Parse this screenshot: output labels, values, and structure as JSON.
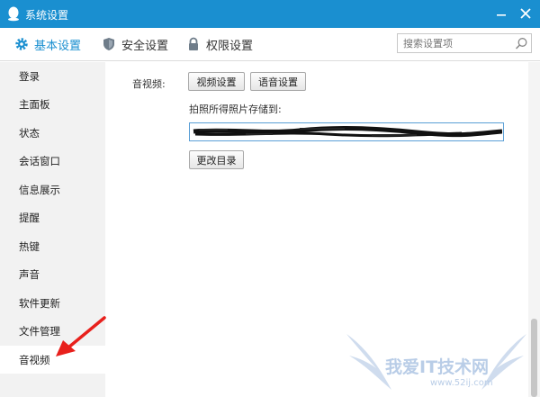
{
  "window": {
    "title": "系统设置",
    "app_icon": "qq-penguin-icon",
    "minimize_icon": "minimize-icon",
    "close_icon": "close-icon",
    "accent_color": "#1a8fd0"
  },
  "topnav": {
    "tabs": [
      {
        "label": "基本设置",
        "icon": "gear-icon",
        "active": true
      },
      {
        "label": "安全设置",
        "icon": "shield-icon",
        "active": false
      },
      {
        "label": "权限设置",
        "icon": "lock-icon",
        "active": false
      }
    ],
    "search": {
      "placeholder": "搜索设置项",
      "icon": "search-icon"
    }
  },
  "sidebar": {
    "items": [
      {
        "label": "登录"
      },
      {
        "label": "主面板"
      },
      {
        "label": "状态"
      },
      {
        "label": "会话窗口"
      },
      {
        "label": "信息展示"
      },
      {
        "label": "提醒"
      },
      {
        "label": "热键"
      },
      {
        "label": "声音"
      },
      {
        "label": "软件更新"
      },
      {
        "label": "文件管理"
      },
      {
        "label": "音视频",
        "active": true
      }
    ]
  },
  "content": {
    "av_label": "音视频:",
    "video_settings_button": "视频设置",
    "voice_settings_button": "语音设置",
    "save_path_label": "拍照所得照片存储到:",
    "save_path_value": "",
    "change_dir_button": "更改目录"
  },
  "annotation": {
    "arrow_icon": "red-arrow-icon",
    "arrow_color": "#e8201c"
  },
  "watermark": {
    "text": "我爱IT技术网",
    "url": "www.52ij.com",
    "logo": "wings-logo-icon"
  }
}
